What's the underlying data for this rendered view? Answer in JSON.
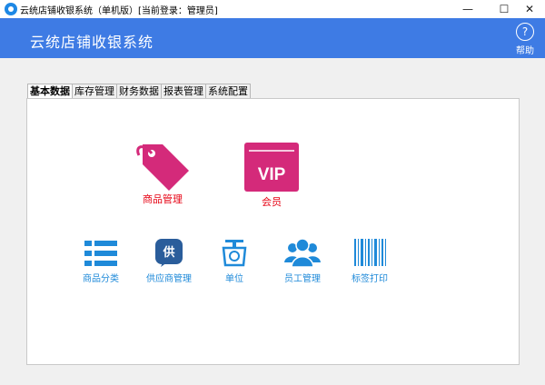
{
  "window": {
    "title": "云统店铺收银系统（单机版）[当前登录：管理员]",
    "minimize_glyph": "—",
    "maximize_glyph": "☐",
    "close_glyph": "✕"
  },
  "header": {
    "title": "云统店铺收银系统",
    "help_icon_glyph": "?",
    "help_label": "帮助"
  },
  "tabs": [
    {
      "label": "基本数据"
    },
    {
      "label": "库存管理"
    },
    {
      "label": "财务数据"
    },
    {
      "label": "报表管理"
    },
    {
      "label": "系统配置"
    }
  ],
  "modules": {
    "product": {
      "label": "商品管理"
    },
    "member": {
      "label": "会员",
      "icon_text": "VIP"
    },
    "category": {
      "label": "商品分类"
    },
    "supplier": {
      "label": "供应商管理",
      "icon_text": "供"
    },
    "unit": {
      "label": "单位"
    },
    "staff": {
      "label": "员工管理"
    },
    "label_print": {
      "label": "标签打印"
    }
  },
  "colors": {
    "header_blue": "#3e7be4",
    "magenta": "#d42a7a",
    "icon_blue": "#1f8ad9",
    "label_red": "#e60012"
  }
}
